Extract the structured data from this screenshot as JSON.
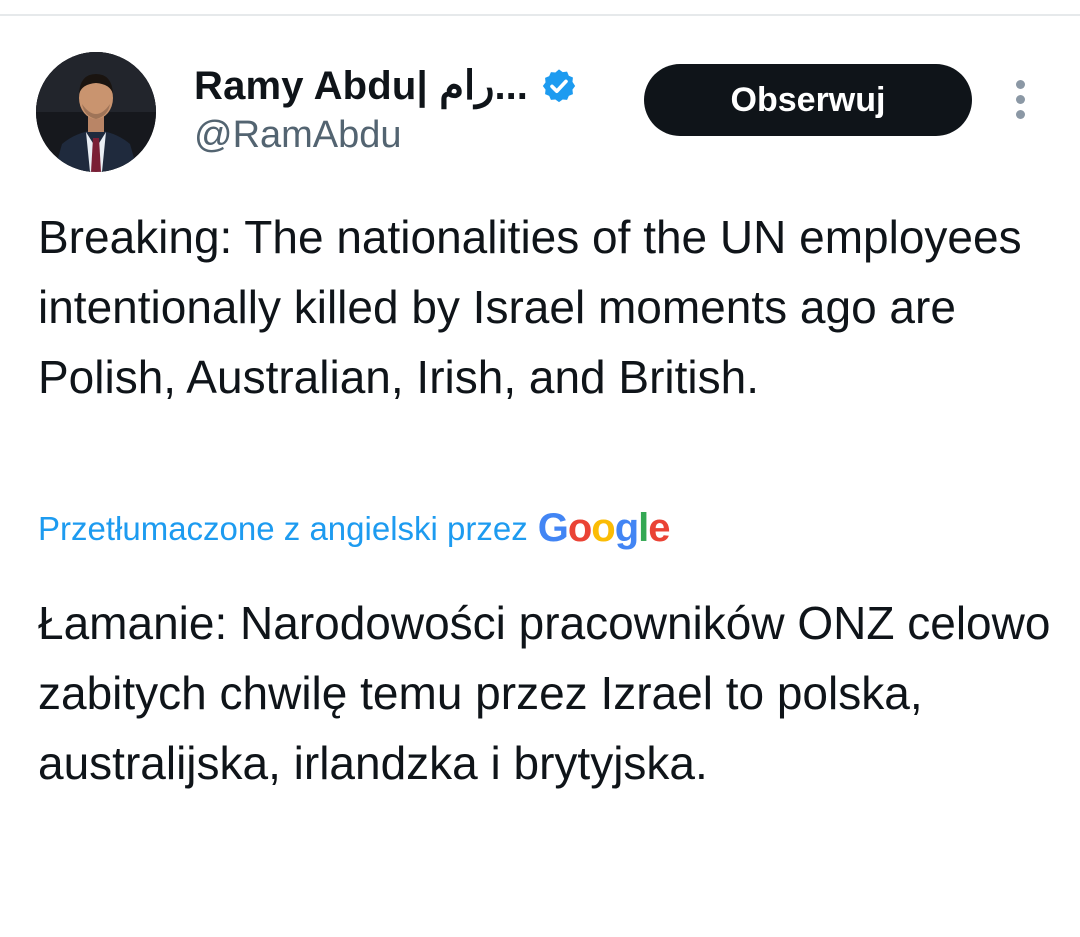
{
  "author": {
    "display_name": "Ramy Abdu| رام...",
    "handle": "@RamAbdu",
    "verified": true
  },
  "actions": {
    "follow_label": "Obserwuj",
    "more_icon": "more-vertical-icon"
  },
  "tweet": {
    "text": "Breaking: The nationalities of the UN employees intentionally killed by Israel moments ago are Polish, Australian, Irish, and British."
  },
  "translation": {
    "label": "Przetłumaczone z angielski przez",
    "provider": "Google",
    "text": "Łamanie: Narodowości pracowników ONZ celowo zabitych chwilę temu przez Izrael to polska, australijska, irlandzka i brytyjska."
  },
  "colors": {
    "accent": "#1d9bf0",
    "button_bg": "#0f1419",
    "text_primary": "#0f1419",
    "text_secondary": "#536471"
  }
}
